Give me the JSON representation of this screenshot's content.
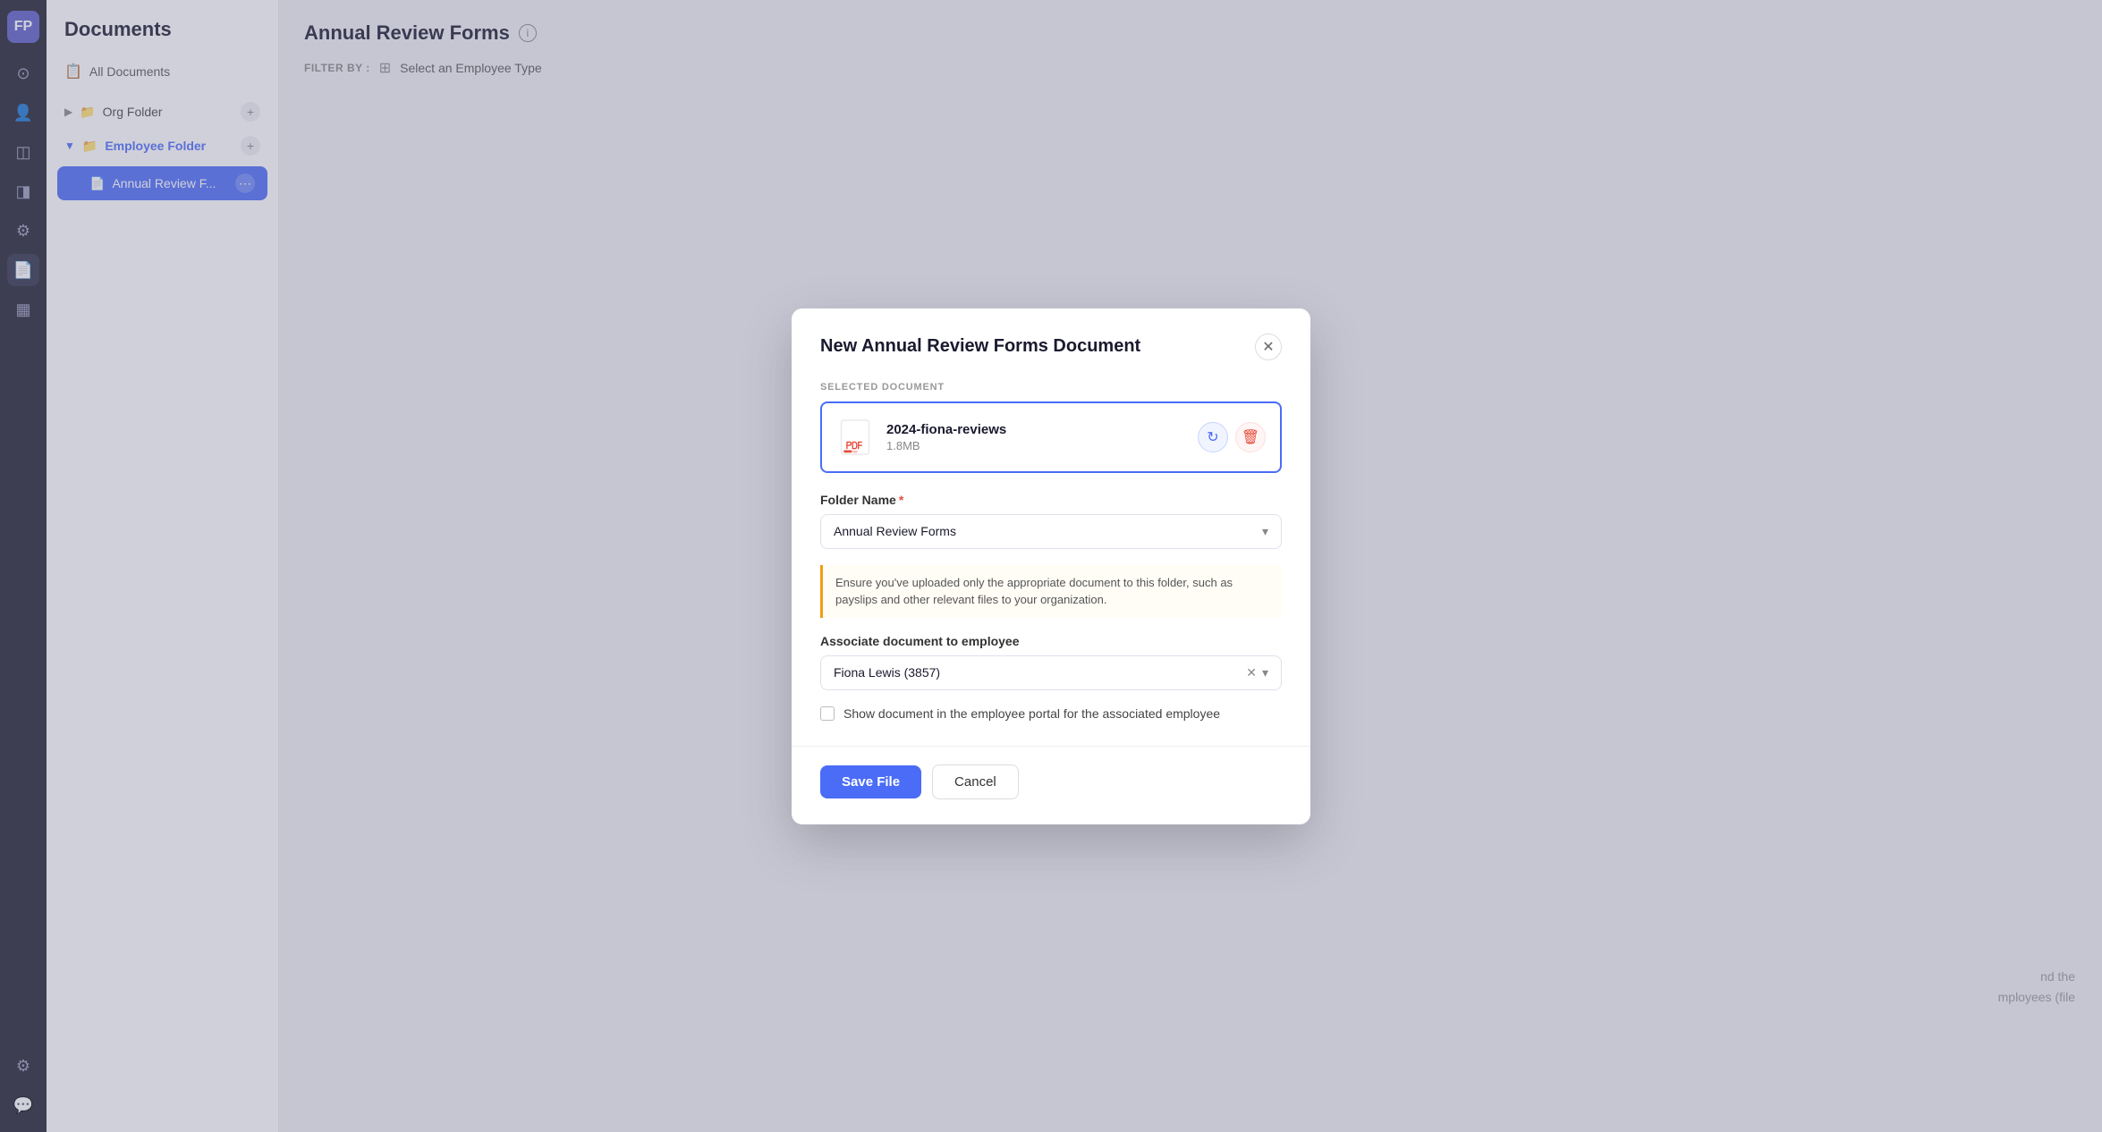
{
  "nav": {
    "logo": "FP",
    "items": [
      {
        "name": "dashboard",
        "icon": "⊙",
        "active": false
      },
      {
        "name": "people",
        "icon": "👤",
        "active": false
      },
      {
        "name": "activity",
        "icon": "◫",
        "active": false
      },
      {
        "name": "calendar",
        "icon": "◨",
        "active": false
      },
      {
        "name": "tools",
        "icon": "⚙",
        "active": false
      },
      {
        "name": "documents",
        "icon": "📄",
        "active": true
      },
      {
        "name": "chart",
        "icon": "▦",
        "active": false
      },
      {
        "name": "settings",
        "icon": "⚙",
        "active": false
      },
      {
        "name": "messages",
        "icon": "💬",
        "active": false
      }
    ]
  },
  "sidebar": {
    "title": "Documents",
    "all_documents_label": "All Documents",
    "org_folder_label": "Org Folder",
    "employee_folder_label": "Employee Folder",
    "active_doc_label": "Annual Review F...",
    "add_icon": "+"
  },
  "main": {
    "title": "Annual Review Forms",
    "filter_label": "FILTER BY :",
    "filter_placeholder": "Select an Employee Type"
  },
  "modal": {
    "title": "New Annual Review Forms Document",
    "selected_doc_label": "SELECTED DOCUMENT",
    "doc_name": "2024-fiona-reviews",
    "doc_size": "1.8MB",
    "folder_name_label": "Folder Name",
    "folder_name_required": true,
    "folder_value": "Annual Review Forms",
    "notice_text": "Ensure you've uploaded only the appropriate document to this folder, such as payslips and other relevant files to your organization.",
    "associate_label": "Associate document to employee",
    "associate_value": "Fiona Lewis (3857)",
    "checkbox_label": "Show document in the employee portal for the associated employee",
    "save_label": "Save File",
    "cancel_label": "Cancel"
  },
  "bg_hint": {
    "line1": "nd the",
    "line2": "mployees (file"
  }
}
